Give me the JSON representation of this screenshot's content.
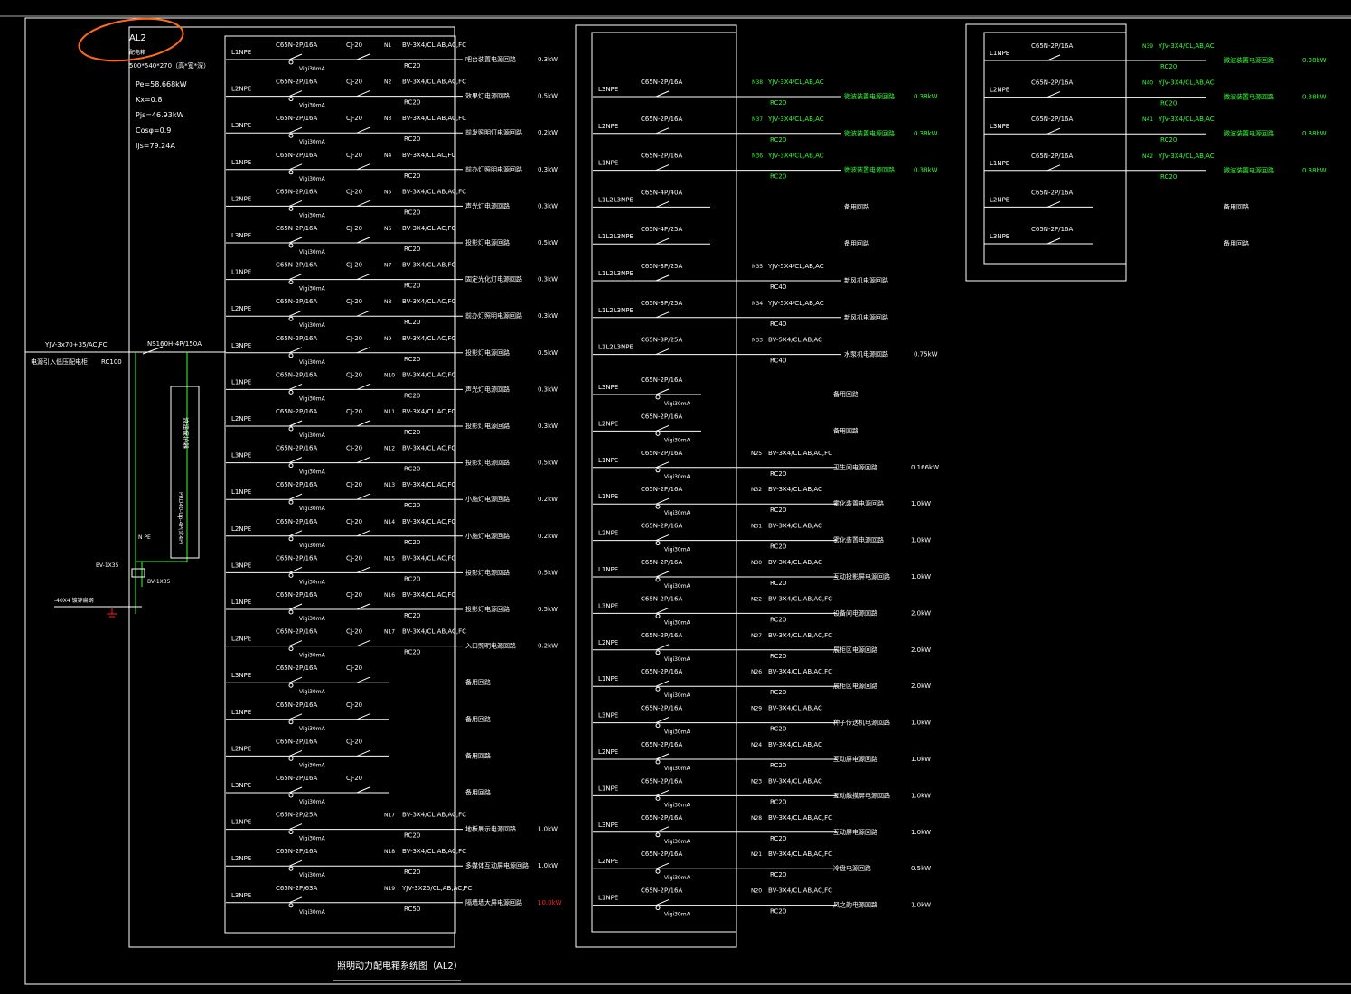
{
  "title": "照明动力配电箱系统图（AL2）",
  "panel": {
    "name": "AL2",
    "sub": "配电箱",
    "size": "500*540*270（高*宽*深）",
    "pe": "Pe=58.668kW",
    "kx": "Kx=0.8",
    "pjs": "Pjs=46.93kW",
    "cos": "Cosφ=0.9",
    "ijs": "Ijs=79.24A"
  },
  "incoming": {
    "cable": "YJV-3x70+35/AC,FC",
    "desc": "电源引入低压配电柜",
    "conduit": "RC100",
    "breaker": "NS160H-4P/150A",
    "spd": "浪涌保护器",
    "spd_model": "PRD40-Up-4P(含4P)",
    "npe": "N PE",
    "bv1": "BV-1X35",
    "bv2": "BV-1X35",
    "ground": "-40X4 镀锌扁钢"
  },
  "col1": [
    {
      "phase": "L1NPE",
      "breaker": "C65N-2P/16A",
      "rcd": "Vigi30mA",
      "ct": "CJ-20",
      "no": "N1",
      "cable": "BV-3X4/CL,AB,AC,FC",
      "conduit": "RC20",
      "desc": "吧台装置电源回路",
      "power": "0.3kW"
    },
    {
      "phase": "L2NPE",
      "breaker": "C65N-2P/16A",
      "rcd": "Vigi30mA",
      "ct": "CJ-20",
      "no": "N2",
      "cable": "BV-3X4/CL,AB,AC,FC",
      "conduit": "RC20",
      "desc": "效果灯电源回路",
      "power": "0.5kW"
    },
    {
      "phase": "L3NPE",
      "breaker": "C65N-2P/16A",
      "rcd": "Vigi30mA",
      "ct": "CJ-20",
      "no": "N3",
      "cable": "BV-3X4/CL,AB,AC,FC",
      "conduit": "RC20",
      "desc": "前发照明灯电源回路",
      "power": "0.2kW"
    },
    {
      "phase": "L1NPE",
      "breaker": "C65N-2P/16A",
      "rcd": "Vigi30mA",
      "ct": "CJ-20",
      "no": "N4",
      "cable": "BV-3X4/CL,AC,FC",
      "conduit": "RC20",
      "desc": "前办灯照明电源回路",
      "power": "0.3kW"
    },
    {
      "phase": "L2NPE",
      "breaker": "C65N-2P/16A",
      "rcd": "Vigi30mA",
      "ct": "CJ-20",
      "no": "N5",
      "cable": "BV-3X4/CL,AB,AC,FC",
      "conduit": "RC20",
      "desc": "声光灯电源回路",
      "power": "0.3kW"
    },
    {
      "phase": "L3NPE",
      "breaker": "C65N-2P/16A",
      "rcd": "Vigi30mA",
      "ct": "CJ-20",
      "no": "N6",
      "cable": "BV-3X4/CL,AC,FC",
      "conduit": "RC20",
      "desc": "投影灯电源回路",
      "power": "0.5kW"
    },
    {
      "phase": "L1NPE",
      "breaker": "C65N-2P/16A",
      "rcd": "Vigi30mA",
      "ct": "CJ-20",
      "no": "N7",
      "cable": "BV-3X4/CL,AB,FC",
      "conduit": "RC20",
      "desc": "固定光化灯电源回路",
      "power": "0.3kW"
    },
    {
      "phase": "L2NPE",
      "breaker": "C65N-2P/16A",
      "rcd": "Vigi30mA",
      "ct": "CJ-20",
      "no": "N8",
      "cable": "BV-3X4/CL,AC,FC",
      "conduit": "RC20",
      "desc": "前办灯照明电源回路",
      "power": "0.3kW"
    },
    {
      "phase": "L3NPE",
      "breaker": "C65N-2P/16A",
      "rcd": "Vigi30mA",
      "ct": "CJ-20",
      "no": "N9",
      "cable": "BV-3X4/CL,AC,FC",
      "conduit": "RC20",
      "desc": "投影灯电源回路",
      "power": "0.5kW"
    },
    {
      "phase": "L1NPE",
      "breaker": "C65N-2P/16A",
      "rcd": "Vigi30mA",
      "ct": "CJ-20",
      "no": "N10",
      "cable": "BV-3X4/CL,AC,FC",
      "conduit": "RC20",
      "desc": "声光灯电源回路",
      "power": "0.3kW"
    },
    {
      "phase": "L2NPE",
      "breaker": "C65N-2P/16A",
      "rcd": "Vigi30mA",
      "ct": "CJ-20",
      "no": "N11",
      "cable": "BV-3X4/CL,AC,FC",
      "conduit": "RC20",
      "desc": "投影灯电源回路",
      "power": "0.3kW"
    },
    {
      "phase": "L3NPE",
      "breaker": "C65N-2P/16A",
      "rcd": "Vigi30mA",
      "ct": "CJ-20",
      "no": "N12",
      "cable": "BV-3X4/CL,AC,FC",
      "conduit": "RC20",
      "desc": "投影灯电源回路",
      "power": "0.5kW"
    },
    {
      "phase": "L1NPE",
      "breaker": "C65N-2P/16A",
      "rcd": "Vigi30mA",
      "ct": "CJ-20",
      "no": "N13",
      "cable": "BV-3X4/CL,AC,FC",
      "conduit": "RC20",
      "desc": "小施灯电源回路",
      "power": "0.2kW"
    },
    {
      "phase": "L2NPE",
      "breaker": "C65N-2P/16A",
      "rcd": "Vigi30mA",
      "ct": "CJ-20",
      "no": "N14",
      "cable": "BV-3X4/CL,AC,FC",
      "conduit": "RC20",
      "desc": "小施灯电源回路",
      "power": "0.2kW"
    },
    {
      "phase": "L3NPE",
      "breaker": "C65N-2P/16A",
      "rcd": "Vigi30mA",
      "ct": "CJ-20",
      "no": "N15",
      "cable": "BV-3X4/CL,AC,FC",
      "conduit": "RC20",
      "desc": "投影灯电源回路",
      "power": "0.5kW"
    },
    {
      "phase": "L1NPE",
      "breaker": "C65N-2P/16A",
      "rcd": "Vigi30mA",
      "ct": "CJ-20",
      "no": "N16",
      "cable": "BV-3X4/CL,AC,FC",
      "conduit": "RC20",
      "desc": "投影灯电源回路",
      "power": "0.5kW"
    },
    {
      "phase": "L2NPE",
      "breaker": "C65N-2P/16A",
      "rcd": "Vigi30mA",
      "ct": "CJ-20",
      "no": "N17",
      "cable": "BV-3X4/CL,AB,AC,FC",
      "conduit": "RC20",
      "desc": "入口照明电源回路",
      "power": "0.2kW"
    },
    {
      "phase": "L3NPE",
      "breaker": "C65N-2P/16A",
      "rcd": "Vigi30mA",
      "ct": "CJ-20",
      "no": "",
      "cable": "",
      "conduit": "",
      "desc": "备用回路",
      "power": ""
    },
    {
      "phase": "L1NPE",
      "breaker": "C65N-2P/16A",
      "rcd": "Vigi30mA",
      "ct": "CJ-20",
      "no": "",
      "cable": "",
      "conduit": "",
      "desc": "备用回路",
      "power": ""
    },
    {
      "phase": "L2NPE",
      "breaker": "C65N-2P/16A",
      "rcd": "Vigi30mA",
      "ct": "CJ-20",
      "no": "",
      "cable": "",
      "conduit": "",
      "desc": "备用回路",
      "power": ""
    },
    {
      "phase": "L3NPE",
      "breaker": "C65N-2P/16A",
      "rcd": "Vigi30mA",
      "ct": "CJ-20",
      "no": "",
      "cable": "",
      "conduit": "",
      "desc": "备用回路",
      "power": ""
    },
    {
      "phase": "L1NPE",
      "breaker": "C65N-2P/25A",
      "rcd": "Vigi30mA",
      "ct": "",
      "no": "N17",
      "cable": "BV-3X4/CL,AB,AC,FC",
      "conduit": "RC20",
      "desc": "地板展示电源回路",
      "power": "1.0kW"
    },
    {
      "phase": "L2NPE",
      "breaker": "C65N-2P/16A",
      "rcd": "Vigi30mA",
      "ct": "",
      "no": "N18",
      "cable": "BV-3X4/CL,AB,AC,FC",
      "conduit": "RC20",
      "desc": "多媒体互动屏电源回路",
      "power": "1.0kW"
    },
    {
      "phase": "L3NPE",
      "breaker": "C65N-2P/63A",
      "rcd": "Vigi30mA",
      "ct": "",
      "no": "N19",
      "cable": "YJV-3X25/CL,AB,AC,FC",
      "conduit": "RC50",
      "desc": "隔墙墙大屏电源回路",
      "power": "10.0kW",
      "alert": true
    }
  ],
  "col2_top": [
    {
      "phase": "L3NPE",
      "breaker": "C65N-2P/16A",
      "no": "N38",
      "cable": "YJV-3X4/CL,AB,AC",
      "conduit": "RC20",
      "desc": "微波装置电源回路",
      "power": "0.38kW",
      "green": true
    },
    {
      "phase": "L2NPE",
      "breaker": "C65N-2P/16A",
      "no": "N37",
      "cable": "YJV-3X4/CL,AB,AC",
      "conduit": "RC20",
      "desc": "微波装置电源回路",
      "power": "0.38kW",
      "green": true
    },
    {
      "phase": "L1NPE",
      "breaker": "C65N-2P/16A",
      "no": "N36",
      "cable": "YJV-3X4/CL,AB,AC",
      "conduit": "RC20",
      "desc": "微波装置电源回路",
      "power": "0.38kW",
      "green": true
    },
    {
      "phase": "L1L2L3NPE",
      "breaker": "C65N-4P/40A",
      "no": "",
      "cable": "",
      "conduit": "",
      "desc": "备用回路",
      "power": ""
    },
    {
      "phase": "L1L2L3NPE",
      "breaker": "C65N-4P/25A",
      "no": "",
      "cable": "",
      "conduit": "",
      "desc": "备用回路",
      "power": ""
    },
    {
      "phase": "L1L2L3NPE",
      "breaker": "C65N-3P/25A",
      "no": "N35",
      "cable": "YJV-5X4/CL,AB,AC",
      "conduit": "RC40",
      "desc": "新风机电源回路",
      "power": ""
    },
    {
      "phase": "L1L2L3NPE",
      "breaker": "C65N-3P/25A",
      "no": "N34",
      "cable": "YJV-5X4/CL,AB,AC",
      "conduit": "RC40",
      "desc": "新风机电源回路",
      "power": ""
    },
    {
      "phase": "L1L2L3NPE",
      "breaker": "C65N-3P/25A",
      "no": "N33",
      "cable": "BV-5X4/CL,AB,AC",
      "conduit": "RC40",
      "desc": "水泵机电源回路",
      "power": "0.75kW"
    }
  ],
  "col2_bottom": [
    {
      "phase": "L3NPE",
      "breaker": "C65N-2P/16A",
      "rcd": "Vigi30mA",
      "no": "",
      "cable": "",
      "conduit": "",
      "desc": "备用回路",
      "power": ""
    },
    {
      "phase": "L2NPE",
      "breaker": "C65N-2P/16A",
      "rcd": "Vigi30mA",
      "no": "",
      "cable": "",
      "conduit": "",
      "desc": "备用回路",
      "power": ""
    },
    {
      "phase": "L1NPE",
      "breaker": "C65N-2P/16A",
      "rcd": "Vigi30mA",
      "no": "N25",
      "cable": "BV-3X4/CL,AB,AC,FC",
      "conduit": "RC20",
      "desc": "卫生间电源回路",
      "power": "0.166kW"
    },
    {
      "phase": "L1NPE",
      "breaker": "C65N-2P/16A",
      "rcd": "Vigi30mA",
      "no": "N32",
      "cable": "BV-3X4/CL,AB,AC",
      "conduit": "RC20",
      "desc": "雾化装置电源回路",
      "power": "1.0kW"
    },
    {
      "phase": "L2NPE",
      "breaker": "C65N-2P/16A",
      "rcd": "Vigi30mA",
      "no": "N31",
      "cable": "BV-3X4/CL,AB,AC",
      "conduit": "RC20",
      "desc": "雾化装置电源回路",
      "power": "1.0kW"
    },
    {
      "phase": "L1NPE",
      "breaker": "C65N-2P/16A",
      "rcd": "Vigi30mA",
      "no": "N30",
      "cable": "BV-3X4/CL,AB,AC",
      "conduit": "RC20",
      "desc": "互动投影屏电源回路",
      "power": "1.0kW"
    },
    {
      "phase": "L3NPE",
      "breaker": "C65N-2P/16A",
      "rcd": "Vigi30mA",
      "no": "N22",
      "cable": "BV-3X4/CL,AB,AC,FC",
      "conduit": "RC20",
      "desc": "设备间电源回路",
      "power": "2.0kW"
    },
    {
      "phase": "L2NPE",
      "breaker": "C65N-2P/16A",
      "rcd": "Vigi30mA",
      "no": "N27",
      "cable": "BV-3X4/CL,AB,AC,FC",
      "conduit": "RC20",
      "desc": "展柜区电源回路",
      "power": "2.0kW"
    },
    {
      "phase": "L1NPE",
      "breaker": "C65N-2P/16A",
      "rcd": "Vigi30mA",
      "no": "N26",
      "cable": "BV-3X4/CL,AB,AC,FC",
      "conduit": "RC20",
      "desc": "展柜区电源回路",
      "power": "2.0kW"
    },
    {
      "phase": "L3NPE",
      "breaker": "C65N-2P/16A",
      "rcd": "Vigi30mA",
      "no": "N29",
      "cable": "BV-3X4/CL,AB,AC",
      "conduit": "RC20",
      "desc": "种子传送机电源回路",
      "power": "1.0kW"
    },
    {
      "phase": "L2NPE",
      "breaker": "C65N-2P/16A",
      "rcd": "Vigi30mA",
      "no": "N24",
      "cable": "BV-3X4/CL,AB,AC",
      "conduit": "RC20",
      "desc": "互动屏电源回路",
      "power": "1.0kW"
    },
    {
      "phase": "L1NPE",
      "breaker": "C65N-2P/16A",
      "rcd": "Vigi30mA",
      "no": "N23",
      "cable": "BV-3X4/CL,AB,AC",
      "conduit": "RC20",
      "desc": "互动触摸屏电源回路",
      "power": "1.0kW"
    },
    {
      "phase": "L3NPE",
      "breaker": "C65N-2P/16A",
      "rcd": "Vigi30mA",
      "no": "N28",
      "cable": "BV-3X4/CL,AB,AC,FC",
      "conduit": "RC20",
      "desc": "互动屏电源回路",
      "power": "1.0kW"
    },
    {
      "phase": "L2NPE",
      "breaker": "C65N-2P/16A",
      "rcd": "Vigi30mA",
      "no": "N21",
      "cable": "BV-3X4/CL,AB,AC,FC",
      "conduit": "RC20",
      "desc": "冷盘电源回路",
      "power": "0.5kW"
    },
    {
      "phase": "L1NPE",
      "breaker": "C65N-2P/16A",
      "rcd": "Vigi30mA",
      "no": "N20",
      "cable": "BV-3X4/CL,AB,AC,FC",
      "conduit": "RC20",
      "desc": "风之韵电源回路",
      "power": "1.0kW"
    }
  ],
  "col3": [
    {
      "phase": "L1NPE",
      "breaker": "C65N-2P/16A",
      "no": "N39",
      "cable": "YJV-3X4/CL,AB,AC",
      "conduit": "RC20",
      "desc": "微波装置电源回路",
      "power": "0.38kW",
      "green": true
    },
    {
      "phase": "L2NPE",
      "breaker": "C65N-2P/16A",
      "no": "N40",
      "cable": "YJV-3X4/CL,AB,AC",
      "conduit": "RC20",
      "desc": "微波装置电源回路",
      "power": "0.38kW",
      "green": true
    },
    {
      "phase": "L3NPE",
      "breaker": "C65N-2P/16A",
      "no": "N41",
      "cable": "YJV-3X4/CL,AB,AC",
      "conduit": "RC20",
      "desc": "微波装置电源回路",
      "power": "0.38kW",
      "green": true
    },
    {
      "phase": "L1NPE",
      "breaker": "C65N-2P/16A",
      "no": "N42",
      "cable": "YJV-3X4/CL,AB,AC",
      "conduit": "RC20",
      "desc": "微波装置电源回路",
      "power": "0.38kW",
      "green": true
    },
    {
      "phase": "L2NPE",
      "breaker": "C65N-2P/16A",
      "no": "",
      "cable": "",
      "conduit": "",
      "desc": "备用回路",
      "power": ""
    },
    {
      "phase": "L3NPE",
      "breaker": "C65N-2P/16A",
      "no": "",
      "cable": "",
      "conduit": "",
      "desc": "备用回路",
      "power": ""
    }
  ],
  "colors": {
    "line": "#ffffff",
    "text": "#ffffff",
    "green": "#33ff33",
    "red": "#ff2020",
    "annotation": "#ff6a1a",
    "background": "#000000"
  }
}
